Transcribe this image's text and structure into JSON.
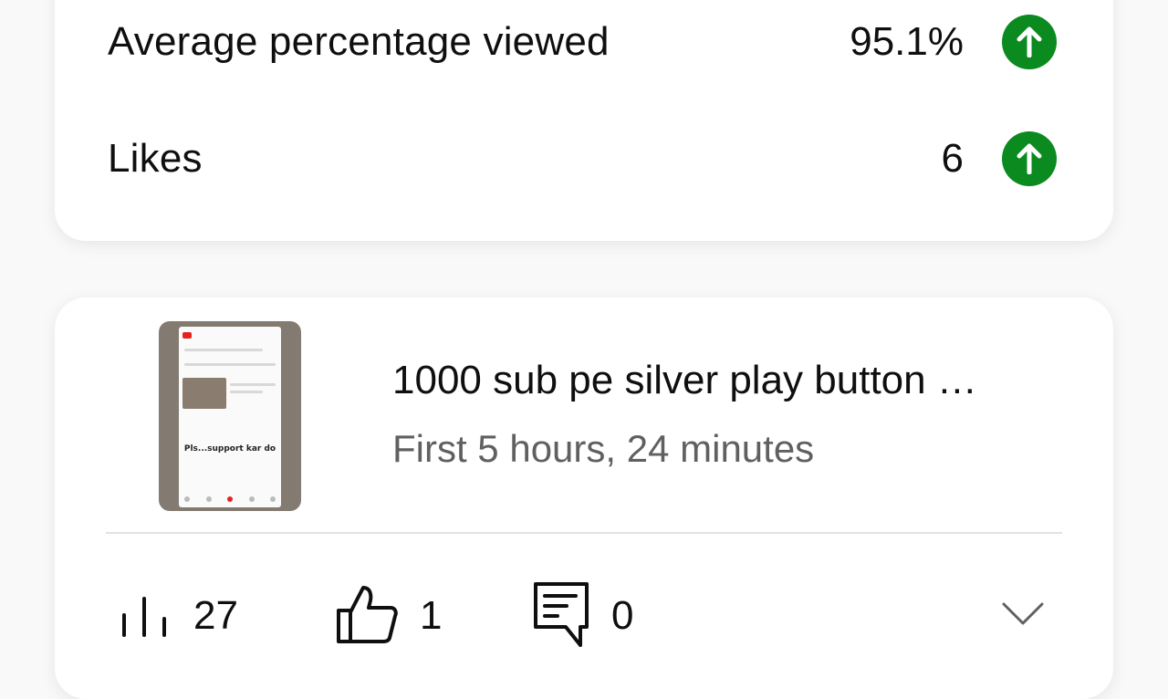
{
  "metrics": [
    {
      "label": "Average percentage viewed",
      "value": "95.1%",
      "trend_icon": "arrow-up-icon"
    },
    {
      "label": "Likes",
      "value": "6",
      "trend_icon": "arrow-up-icon"
    }
  ],
  "video": {
    "title": "1000 sub pe silver play button …",
    "subtitle": "First 5 hours, 24 minutes",
    "thumbnail": {
      "caption": "Pls...support kar do"
    },
    "stats": {
      "views": "27",
      "likes": "1",
      "comments": "0"
    }
  },
  "colors": {
    "trend_up": "#0a8a1f",
    "text": "#0f0f0f",
    "secondary_text": "#606060"
  }
}
